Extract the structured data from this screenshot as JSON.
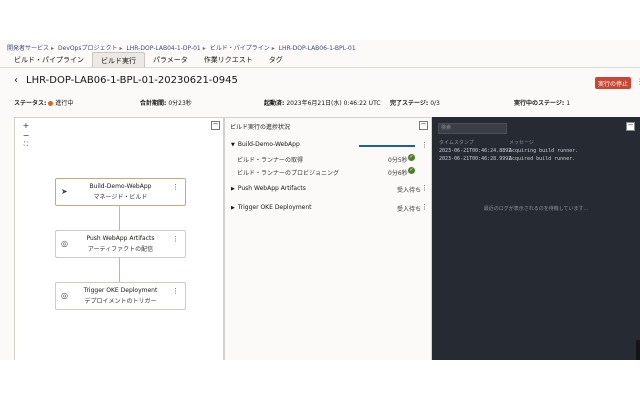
{
  "breadcrumb": [
    "開発者サービス",
    "DevOpsプロジェクト",
    "LHR-DOP-LAB04-1-DP-01",
    "ビルド・パイプライン",
    "LHR-DOP-LAB06-1-BPL-01"
  ],
  "tabs": [
    "ビルド・パイプライン",
    "ビルド実行",
    "パラメータ",
    "作業リクエスト",
    "タグ"
  ],
  "active_tab": "ビルド実行",
  "header": {
    "back_icon": "‹",
    "title": "LHR-DOP-LAB06-1-BPL-01-20230621-0945",
    "stop_button": "実行の停止"
  },
  "summary": {
    "status_label": "ステータス:",
    "status_value": "進行中",
    "duration_label": "合計期間:",
    "duration_value": "0分23秒",
    "start_label": "起動済:",
    "start_value": "2023年6月21日(水) 0:46:22 UTC",
    "completed_label": "完了ステージ:",
    "completed_value": "0/3",
    "running_label": "実行中のステージ:",
    "running_value": "1",
    "status_color": "#d36a1b"
  },
  "graph": {
    "zoom_in": "+",
    "zoom_out": "−",
    "fit": "⛶",
    "collapse": "−",
    "nodes": [
      {
        "title": "Build-Demo-WebApp",
        "subtitle": "マネージド・ビルド",
        "icon": "send-icon"
      },
      {
        "title": "Push WebApp Artifacts",
        "subtitle": "アーティファクトの配信",
        "icon": "check-circle-icon"
      },
      {
        "title": "Trigger OKE Deployment",
        "subtitle": "デプロイメントのトリガー",
        "icon": "check-circle-icon"
      }
    ]
  },
  "progress_panel": {
    "title": "ビルド実行の進捗状況",
    "collapse": "−",
    "stages": [
      {
        "name": "Build-Demo-WebApp",
        "expanded": true,
        "progress": 1.0,
        "steps": [
          {
            "name": "ビルド・ランナーの取得",
            "time": "0分5秒",
            "done": true
          },
          {
            "name": "ビルド・ランナーのプロビジョニング",
            "time": "0分6秒",
            "done": true
          }
        ]
      },
      {
        "name": "Push WebApp Artifacts",
        "expanded": false,
        "state": "受入待ち"
      },
      {
        "name": "Trigger OKE Deployment",
        "expanded": false,
        "state": "受入待ち"
      }
    ]
  },
  "logs": {
    "search_placeholder": "検索",
    "columns": [
      "タイムスタンプ",
      "メッセージ"
    ],
    "lines": [
      {
        "ts": "2023-06-21T00:46:24.889Z",
        "msg": "Acquiring build runner."
      },
      {
        "ts": "2023-06-21T00:46:28.999Z",
        "msg": "Acquired build runner."
      }
    ],
    "end_message": "最近のログが表示されるのを待機しています...",
    "collapse": "−"
  }
}
